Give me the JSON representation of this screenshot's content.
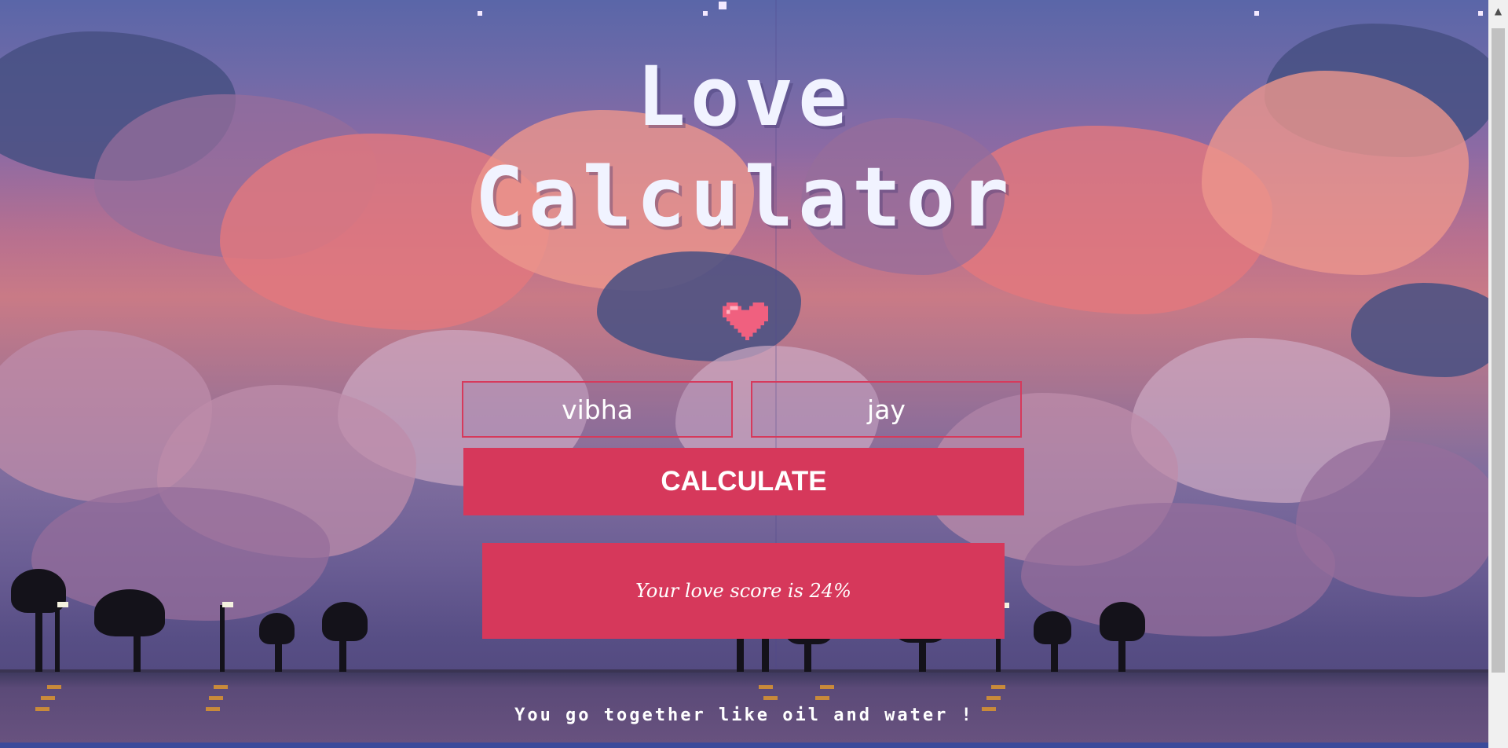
{
  "app": {
    "title_line1": "Love",
    "title_line2": "Calculator"
  },
  "icons": {
    "heart": "heart-icon",
    "scroll_up": "chevron-up-icon"
  },
  "form": {
    "name1_value": "vibha",
    "name2_value": "jay",
    "calculate_label": "CALCULATE"
  },
  "result": {
    "score_text": "Your love score is 24%",
    "verdict_text": "You go together like oil and water !"
  },
  "colors": {
    "accent": "#d6385b",
    "title": "#f1f3ff",
    "heart": "#f0607f"
  }
}
